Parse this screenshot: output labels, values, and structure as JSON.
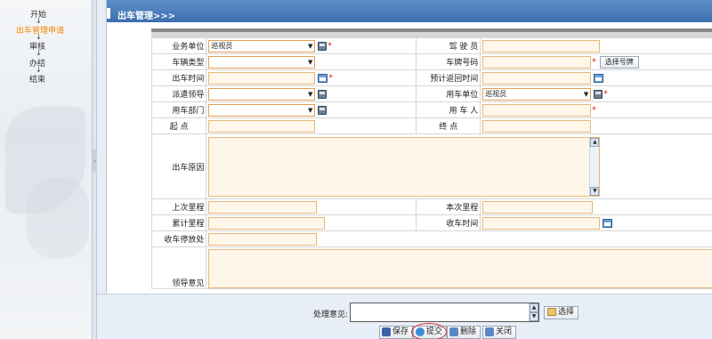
{
  "workflow": {
    "steps": [
      {
        "label": "开始",
        "active": false
      },
      {
        "label": "出车管理申请",
        "active": true
      },
      {
        "label": "审核",
        "active": false
      },
      {
        "label": "办结",
        "active": false
      },
      {
        "label": "结束",
        "active": false
      }
    ],
    "arrow": "↓"
  },
  "page": {
    "title": "出车管理>>>"
  },
  "form": {
    "business_unit": {
      "label": "业务单位",
      "value": "巡视员"
    },
    "driver": {
      "label": "驾 驶 员",
      "value": ""
    },
    "vehicle_type": {
      "label": "车辆类型",
      "value": ""
    },
    "plate_number": {
      "label": "车牌号码",
      "value": "",
      "button": "选择号牌"
    },
    "depart_time": {
      "label": "出车时间",
      "value": ""
    },
    "expected_return": {
      "label": "预计返回时间",
      "value": ""
    },
    "dispatcher": {
      "label": "派遣领导",
      "value": ""
    },
    "using_unit": {
      "label": "用车单位",
      "value": "巡视员"
    },
    "using_dept": {
      "label": "用车部门",
      "value": ""
    },
    "user": {
      "label": "用 车 人",
      "value": ""
    },
    "start_point": {
      "label": "起 点",
      "value": ""
    },
    "end_point": {
      "label": "终 点",
      "value": ""
    },
    "reason": {
      "label": "出车原因",
      "value": ""
    },
    "last_mileage": {
      "label": "上次里程",
      "value": ""
    },
    "this_mileage": {
      "label": "本次里程",
      "value": ""
    },
    "total_mileage": {
      "label": "累计里程",
      "value": ""
    },
    "return_time": {
      "label": "收车时间",
      "value": ""
    },
    "parking": {
      "label": "收车停放处",
      "value": ""
    },
    "leader_opinion": {
      "label": "领导意见",
      "value": ""
    },
    "required_mark": "*"
  },
  "bottom": {
    "opinion_label": "处理意见:",
    "opinion_value": "",
    "pick_label": "选择",
    "buttons": {
      "save": "保存",
      "submit": "提交",
      "delete": "删除",
      "close": "关闭"
    }
  },
  "scroll_glyphs": {
    "up": "▲",
    "down": "▼"
  },
  "dropdown_glyph": "▼",
  "splitter_glyph": "‹",
  "colors": {
    "title_bar": "#4a7cbc",
    "active_step": "#f08a00",
    "required": "#e60000",
    "input_border": "#e8b77a"
  }
}
